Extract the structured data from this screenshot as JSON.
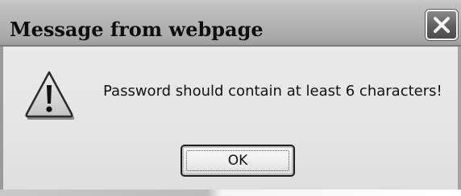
{
  "dialog": {
    "title": "Message from webpage",
    "message": "Password should contain at least 6 characters!",
    "ok_label": "OK"
  },
  "icons": {
    "close": "close-icon",
    "warning": "warning-icon"
  }
}
